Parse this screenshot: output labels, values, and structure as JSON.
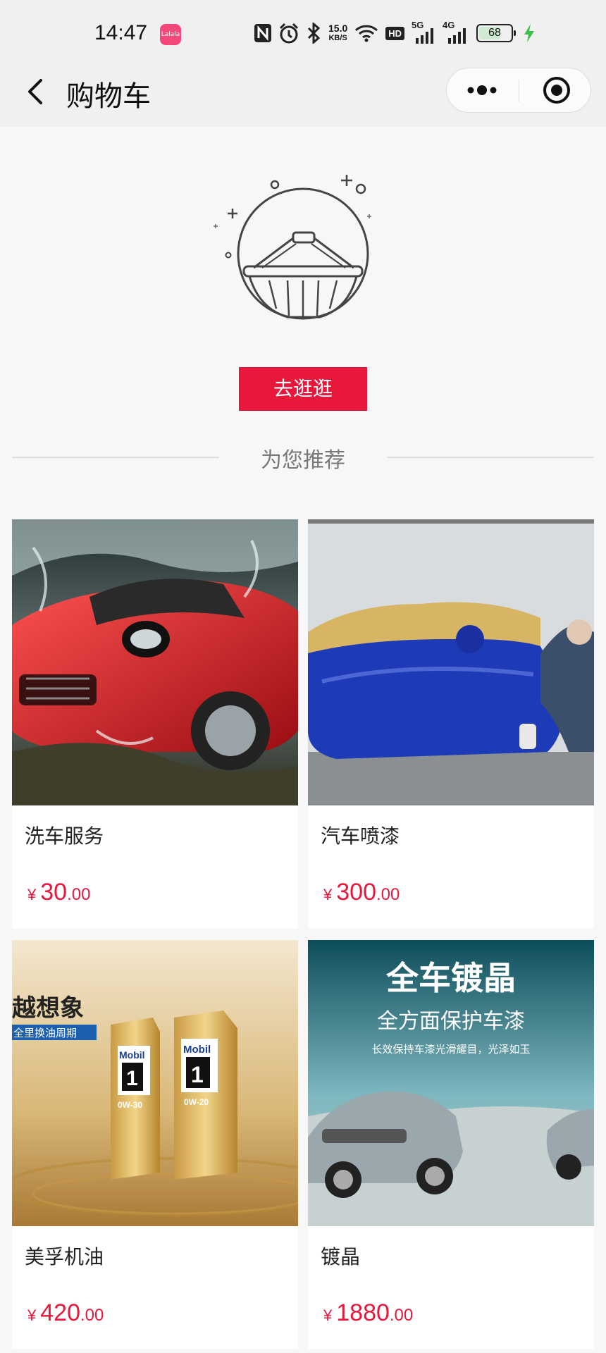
{
  "status_bar": {
    "time": "14:47",
    "app_badge": "Lalala",
    "net_speed_value": "15.0",
    "net_speed_unit": "KB/S",
    "hd_label": "HD",
    "signal_5g_label": "5G",
    "signal_4g_label": "4G",
    "battery": "68"
  },
  "nav": {
    "title": "购物车"
  },
  "empty_cart": {
    "go_shopping_label": "去逛逛"
  },
  "recommend": {
    "title": "为您推荐",
    "products": [
      {
        "name": "洗车服务",
        "currency": "¥",
        "price_int": "30",
        "price_dec": ".00",
        "image": "red-sports-car-wash"
      },
      {
        "name": "汽车喷漆",
        "currency": "¥",
        "price_int": "300",
        "price_dec": ".00",
        "image": "blue-car-spray-paint"
      },
      {
        "name": "美孚机油",
        "currency": "¥",
        "price_int": "420",
        "price_dec": ".00",
        "image": "mobil-1-oil-bottles",
        "image_text": [
          "越想象",
          "全里换油周期",
          "Mobil",
          "1",
          "Mobil",
          "1",
          "0W-30",
          "0W-20"
        ]
      },
      {
        "name": "镀晶",
        "currency": "¥",
        "price_int": "1880",
        "price_dec": ".00",
        "image": "car-coating-poster",
        "image_text": [
          "全车镀晶",
          "全方面保护车漆",
          "长效保持车漆光滑耀目，光泽如玉"
        ]
      }
    ]
  },
  "colors": {
    "accent": "#e8173c",
    "background": "#f7f7f7",
    "nav_bg": "#f0f0f0"
  }
}
